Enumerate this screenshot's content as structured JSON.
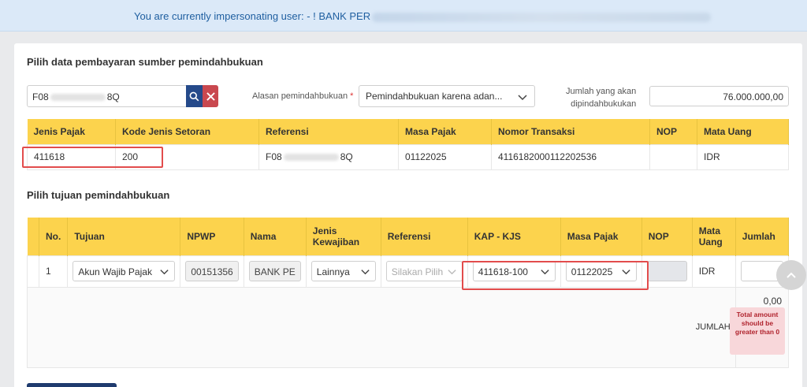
{
  "banner": {
    "text": "You are currently impersonating user: - ! BANK PER"
  },
  "source": {
    "title": "Pilih data pembayaran sumber pemindahbukuan",
    "search_prefix": "F08",
    "search_suffix": "8Q",
    "reason_label": "Alasan pemindahbukuan",
    "reason_required": "*",
    "reason_value": "Pemindahbukuan karena adan...",
    "amount_label_line1": "Jumlah yang akan",
    "amount_label_line2": "dipindahbukukan",
    "amount_value": "76.000.000,00",
    "columns": [
      "Jenis Pajak",
      "Kode Jenis Setoran",
      "Referensi",
      "Masa Pajak",
      "Nomor Transaksi",
      "NOP",
      "Mata Uang"
    ],
    "row": {
      "jenis_pajak": "411618",
      "kode_jenis_setoran": "200",
      "referensi_prefix": "F08",
      "referensi_suffix": "8Q",
      "masa_pajak": "01122025",
      "nomor_transaksi": "4116182000112202536",
      "nop": "",
      "mata_uang": "IDR"
    }
  },
  "destination": {
    "title": "Pilih tujuan pemindahbukuan",
    "columns": {
      "no": "No.",
      "tujuan": "Tujuan",
      "npwp": "NPWP",
      "nama": "Nama",
      "jenis_kewajiban_1": "Jenis",
      "jenis_kewajiban_2": "Kewajiban",
      "referensi": "Referensi",
      "kap_kjs": "KAP - KJS",
      "masa_pajak": "Masa Pajak",
      "nop": "NOP",
      "mata_uang_1": "Mata",
      "mata_uang_2": "Uang",
      "jumlah": "Jumlah"
    },
    "row": {
      "no": "1",
      "tujuan": "Akun Wajib Pajak",
      "npwp": "00151356",
      "nama": "BANK PE",
      "jenis_kewajiban": "Lainnya",
      "referensi_placeholder": "Silakan Pilih",
      "kap_kjs": "411618-100",
      "masa_pajak": "01122025",
      "nop": "",
      "mata_uang": "IDR",
      "jumlah": ""
    },
    "total_value": "0,00",
    "total_label": "JUMLAH",
    "error": "Total amount should be greater than 0"
  },
  "colors": {
    "header_yellow": "#fcd34d",
    "primary": "#254a8a",
    "danger": "#c9484f",
    "highlight": "#e24c4c"
  },
  "icons": [
    "search-icon",
    "close-icon",
    "chevron-down-icon",
    "chevron-up-icon"
  ]
}
